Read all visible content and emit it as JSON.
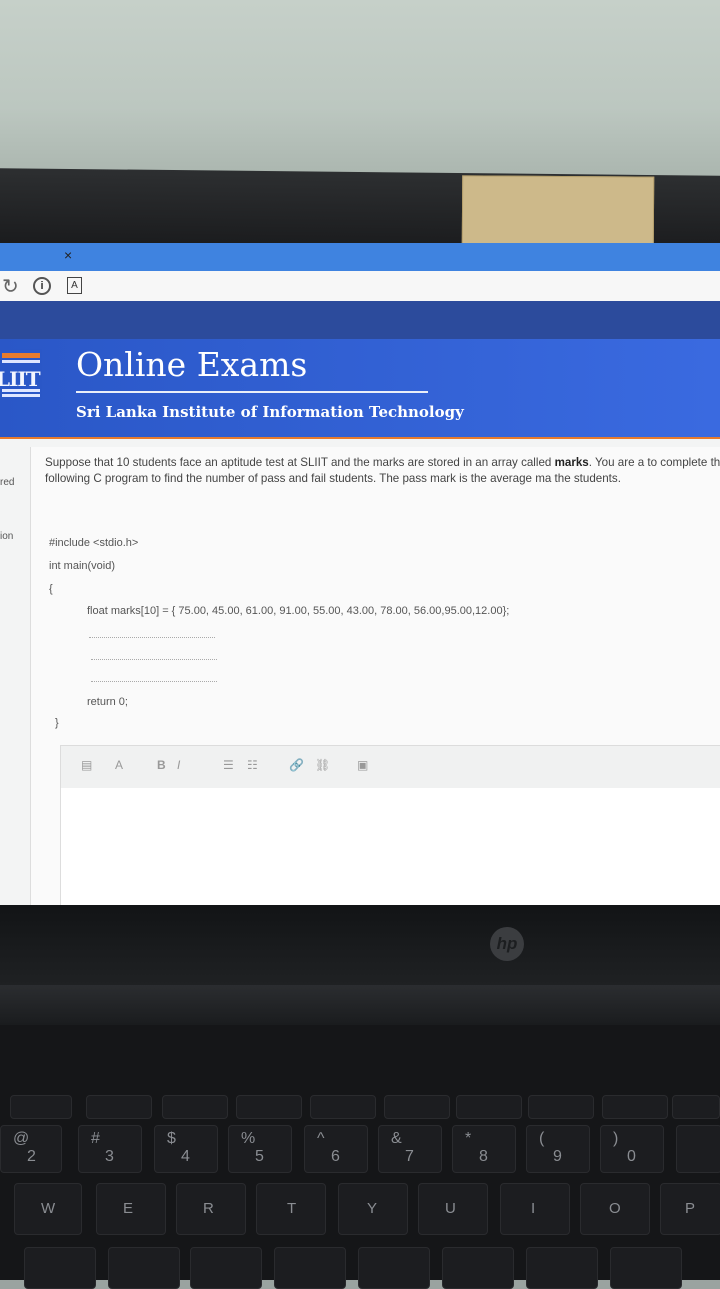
{
  "browser": {
    "tab_close": "×",
    "icons": [
      "reload-icon",
      "info-icon",
      "pdf-icon"
    ]
  },
  "header": {
    "logo_text": "LIIT",
    "title": "Online Exams",
    "subtitle": "Sri Lanka Institute of Information Technology"
  },
  "sidebar": {
    "clip_1": "red",
    "clip_2": "ion"
  },
  "question": {
    "text_pre": "Suppose that 10 students face an aptitude test at SLIIT and the marks are stored in an array called ",
    "text_bold": "marks",
    "text_post": ". You are a to complete the following C program to find the number of pass and fail students. The pass mark is the average ma the students.",
    "code": {
      "include": "#include <stdio.h>",
      "main": "int main(void)",
      "open_brace": "{",
      "decl": "float marks[10] = { 75.00, 45.00, 61.00, 91.00, 55.00, 43.00, 78.00, 56.00,95.00,12.00};",
      "ret": "return 0;",
      "close_brace": "}"
    }
  },
  "editor_toolbar": {
    "paragraph": "A",
    "bold": "B",
    "italic": "I",
    "ul": "☰",
    "ol": "☷",
    "link": "🔗",
    "unlink": "⛓",
    "image": "▣"
  },
  "laptop": {
    "brand": "hp"
  },
  "keyboard": {
    "number_row": [
      {
        "top": "@",
        "bottom": "2"
      },
      {
        "top": "#",
        "bottom": "3"
      },
      {
        "top": "$",
        "bottom": "4"
      },
      {
        "top": "%",
        "bottom": "5"
      },
      {
        "top": "^",
        "bottom": "6"
      },
      {
        "top": "&",
        "bottom": "7"
      },
      {
        "top": "*",
        "bottom": "8"
      },
      {
        "top": "(",
        "bottom": "9"
      },
      {
        "top": ")",
        "bottom": "0"
      }
    ],
    "letter_row": [
      "W",
      "E",
      "R",
      "T",
      "Y",
      "U",
      "I",
      "O",
      "P"
    ]
  },
  "colors": {
    "header_blue": "#3a6ae0",
    "accent_orange": "#e77b2c",
    "tab_blue": "#3f83e0"
  }
}
